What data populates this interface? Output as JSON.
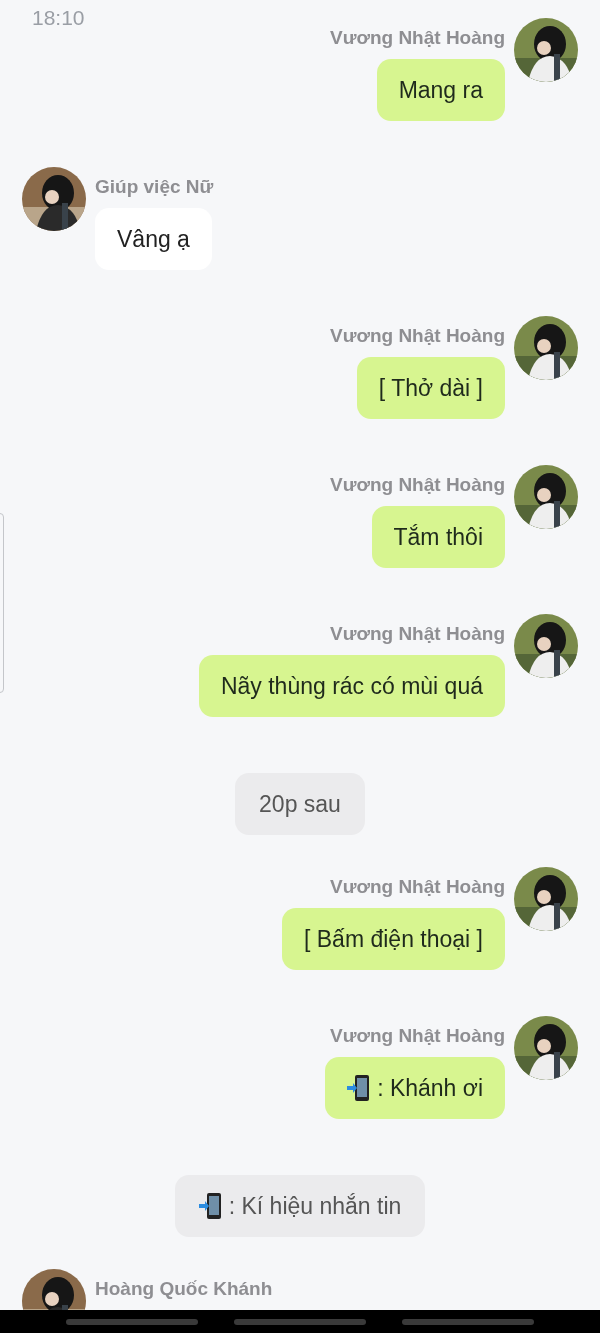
{
  "status_bar": {
    "time": "18:10"
  },
  "messages": [
    {
      "kind": "outgoing",
      "sender": "Vương Nhật Hoàng",
      "text": "Mang ra"
    },
    {
      "kind": "incoming",
      "sender": "Giúp việc Nữ",
      "text": "Vâng ạ"
    },
    {
      "kind": "outgoing",
      "sender": "Vương Nhật Hoàng",
      "text": "[ Thở dài ]"
    },
    {
      "kind": "outgoing",
      "sender": "Vương Nhật Hoàng",
      "text": "Tắm thôi"
    },
    {
      "kind": "outgoing",
      "sender": "Vương Nhật Hoàng",
      "text": "Nãy thùng rác có mùi quá"
    },
    {
      "kind": "narration",
      "text": "20p sau"
    },
    {
      "kind": "outgoing",
      "sender": "Vương Nhật Hoàng",
      "text": "[ Bấm điện thoại ]"
    },
    {
      "kind": "outgoing",
      "sender": "Vương Nhật Hoàng",
      "text": ": Khánh ơi",
      "phone_icon": true
    },
    {
      "kind": "narration",
      "text": ": Kí hiệu nhắn tin",
      "phone_icon": true
    },
    {
      "kind": "incoming",
      "sender": "Hoàng Quốc Khánh"
    }
  ]
}
